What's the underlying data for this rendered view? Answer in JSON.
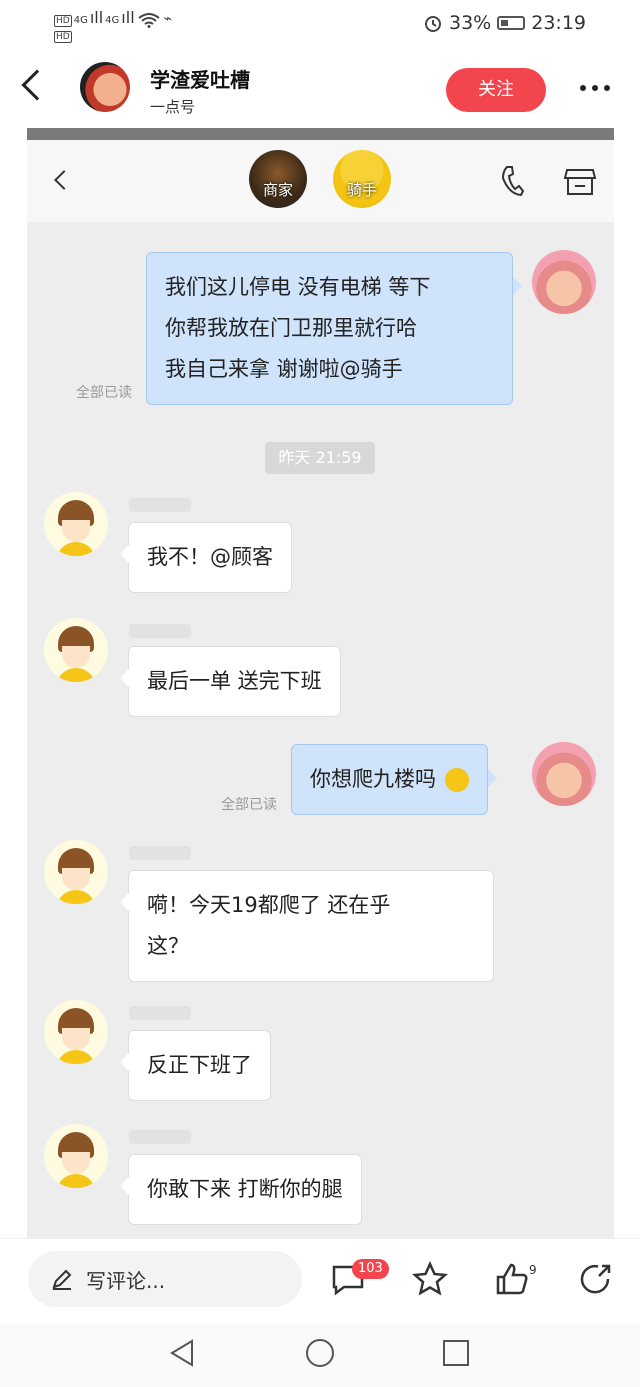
{
  "status_bar": {
    "hd1": "HD",
    "hd2": "HD",
    "sig1": "4G",
    "sig2": "4G",
    "battery": "33%",
    "time": "23:19"
  },
  "header": {
    "account_name": "学渣爱吐槽",
    "account_sub": "一点号",
    "follow_label": "关注"
  },
  "chat": {
    "roles": [
      {
        "label": "商家"
      },
      {
        "label": "骑手"
      }
    ],
    "messages": [
      {
        "from": "me",
        "text_lines": [
          "我们这儿停电 没有电梯  等下",
          "你帮我放在门卫那里就行哈",
          "我自己来拿  谢谢啦@骑手"
        ],
        "read": "全部已读"
      },
      {
        "type": "time",
        "text": "昨天 21:59"
      },
      {
        "from": "rider",
        "text_lines": [
          "我不！@顾客"
        ]
      },
      {
        "from": "rider",
        "text_lines": [
          "最后一单  送完下班"
        ]
      },
      {
        "from": "me",
        "text_lines": [
          "你想爬九楼吗"
        ],
        "emoji": "shush-emoji",
        "read": "全部已读"
      },
      {
        "from": "rider",
        "text_lines": [
          "嗬！今天19都爬了  还在乎",
          "这？"
        ]
      },
      {
        "from": "rider",
        "text_lines": [
          "反正下班了"
        ]
      },
      {
        "from": "rider",
        "text_lines": [
          "你敢下来  打断你的腿"
        ]
      }
    ]
  },
  "bottom_bar": {
    "comment_placeholder": "写评论...",
    "comment_count": "103",
    "like_count": "9"
  },
  "colors": {
    "accent": "#f3454e",
    "my_bubble": "#cfe3fa",
    "chat_bg": "#ededed"
  }
}
